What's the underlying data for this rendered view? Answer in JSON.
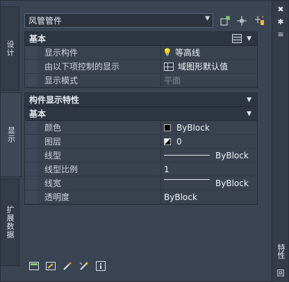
{
  "window": {
    "title": "特性",
    "close_glyph": "✖",
    "pin_glyph": "✱",
    "options_glyph": "≡",
    "bottom_glyph": "回"
  },
  "left_tabs": [
    {
      "label": "设计",
      "active": false
    },
    {
      "label": "显示",
      "active": true
    },
    {
      "label": "扩展数据",
      "active": false
    }
  ],
  "object_selector": {
    "value": "风管管件",
    "toolbar_icons": [
      "quick-select-icon",
      "select-objects-icon",
      "pickadd-toggle-icon"
    ]
  },
  "section_basic": {
    "header": "基本",
    "rows": [
      {
        "label": "显示构件",
        "value": "等高线",
        "icon": "bulb-icon"
      },
      {
        "label": "由以下项控制的显示",
        "value": "域图形默认值",
        "icon": "grid-icon"
      },
      {
        "label": "显示模式",
        "value": "平面",
        "dim": true
      }
    ]
  },
  "section_component": {
    "header": "构件显示特性",
    "sub_header": "基本",
    "rows": [
      {
        "label": "颜色",
        "value": "ByBlock",
        "icon": "color-swatch-icon"
      },
      {
        "label": "图层",
        "value": "0",
        "icon": "layer-icon"
      },
      {
        "label": "线型",
        "value": "ByBlock",
        "icon": "linetype-sample"
      },
      {
        "label": "线型比例",
        "value": "1"
      },
      {
        "label": "线宽",
        "value": "ByBlock",
        "icon": "lineweight-sample"
      },
      {
        "label": "透明度",
        "value": "ByBlock"
      }
    ]
  },
  "bottom_toolbar": [
    "edit-display-icon",
    "edit-style-icon",
    "paint-icon",
    "match-props-icon",
    "info-icon"
  ]
}
